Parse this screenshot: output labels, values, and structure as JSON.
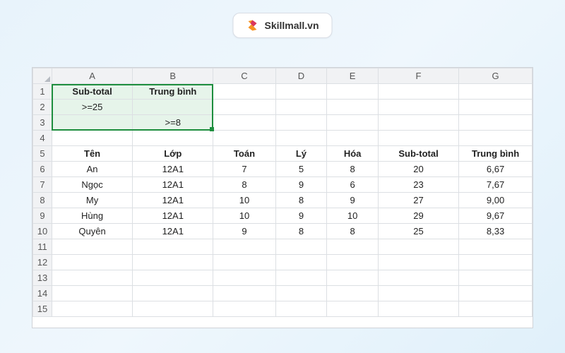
{
  "brand": {
    "name": "Skillmall.vn"
  },
  "columns": [
    "A",
    "B",
    "C",
    "D",
    "E",
    "F",
    "G"
  ],
  "row_numbers": [
    1,
    2,
    3,
    4,
    5,
    6,
    7,
    8,
    9,
    10,
    11,
    12,
    13,
    14,
    15
  ],
  "criteria": {
    "header_a": "Sub-total",
    "header_b": "Trung bình",
    "a2": ">=25",
    "b3": ">=8"
  },
  "table": {
    "headers": {
      "ten": "Tên",
      "lop": "Lớp",
      "toan": "Toán",
      "ly": "Lý",
      "hoa": "Hóa",
      "subtotal": "Sub-total",
      "tb": "Trung bình"
    },
    "rows": [
      {
        "ten": "An",
        "lop": "12A1",
        "toan": "7",
        "ly": "5",
        "hoa": "8",
        "sub": "20",
        "tb": "6,67"
      },
      {
        "ten": "Ngọc",
        "lop": "12A1",
        "toan": "8",
        "ly": "9",
        "hoa": "6",
        "sub": "23",
        "tb": "7,67"
      },
      {
        "ten": "My",
        "lop": "12A1",
        "toan": "10",
        "ly": "8",
        "hoa": "9",
        "sub": "27",
        "tb": "9,00"
      },
      {
        "ten": "Hùng",
        "lop": "12A1",
        "toan": "10",
        "ly": "9",
        "hoa": "10",
        "sub": "29",
        "tb": "9,67"
      },
      {
        "ten": "Quyên",
        "lop": "12A1",
        "toan": "9",
        "ly": "8",
        "hoa": "8",
        "sub": "25",
        "tb": "8,33"
      }
    ]
  },
  "chart_data": {
    "type": "table",
    "columns": [
      "Tên",
      "Lớp",
      "Toán",
      "Lý",
      "Hóa",
      "Sub-total",
      "Trung bình"
    ],
    "rows": [
      [
        "An",
        "12A1",
        7,
        5,
        8,
        20,
        6.67
      ],
      [
        "Ngọc",
        "12A1",
        8,
        9,
        6,
        23,
        7.67
      ],
      [
        "My",
        "12A1",
        10,
        8,
        9,
        27,
        9.0
      ],
      [
        "Hùng",
        "12A1",
        10,
        9,
        10,
        29,
        9.67
      ],
      [
        "Quyên",
        "12A1",
        9,
        8,
        8,
        25,
        8.33
      ]
    ]
  }
}
